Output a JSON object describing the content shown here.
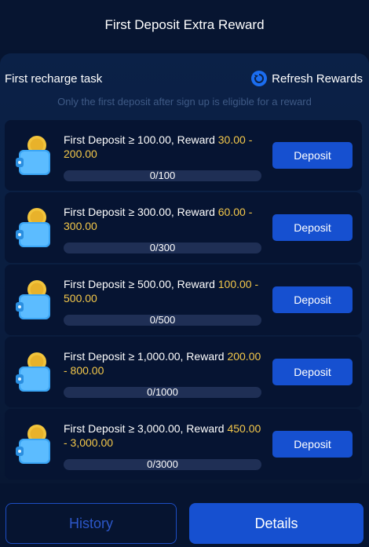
{
  "header": {
    "title": "First Deposit Extra Reward"
  },
  "task": {
    "title": "First recharge task",
    "refresh_label": "Refresh Rewards",
    "note": "Only the first deposit after sign up is eligible for a reward"
  },
  "colors": {
    "accent": "#1650d0",
    "gold": "#f4c84a",
    "background": "#061430"
  },
  "cards": [
    {
      "label": "First Deposit ≥ 100.00, Reward ",
      "reward": "30.00 - 200.00",
      "progress": "0/100",
      "progress_fraction": 0,
      "button": "Deposit"
    },
    {
      "label": "First Deposit ≥ 300.00, Reward ",
      "reward": "60.00 - 300.00",
      "progress": "0/300",
      "progress_fraction": 0,
      "button": "Deposit"
    },
    {
      "label": "First Deposit ≥ 500.00, Reward ",
      "reward": "100.00 - 500.00",
      "progress": "0/500",
      "progress_fraction": 0,
      "button": "Deposit"
    },
    {
      "label": "First Deposit ≥ 1,000.00, Reward ",
      "reward": "200.00 - 800.00",
      "progress": "0/1000",
      "progress_fraction": 0,
      "button": "Deposit"
    },
    {
      "label": "First Deposit ≥ 3,000.00, Reward ",
      "reward": "450.00 - 3,000.00",
      "progress": "0/3000",
      "progress_fraction": 0,
      "button": "Deposit"
    }
  ],
  "footer": {
    "history_label": "History",
    "details_label": "Details"
  },
  "icons": {
    "refresh": "refresh-icon",
    "wallet": "wallet-coin-icon"
  }
}
